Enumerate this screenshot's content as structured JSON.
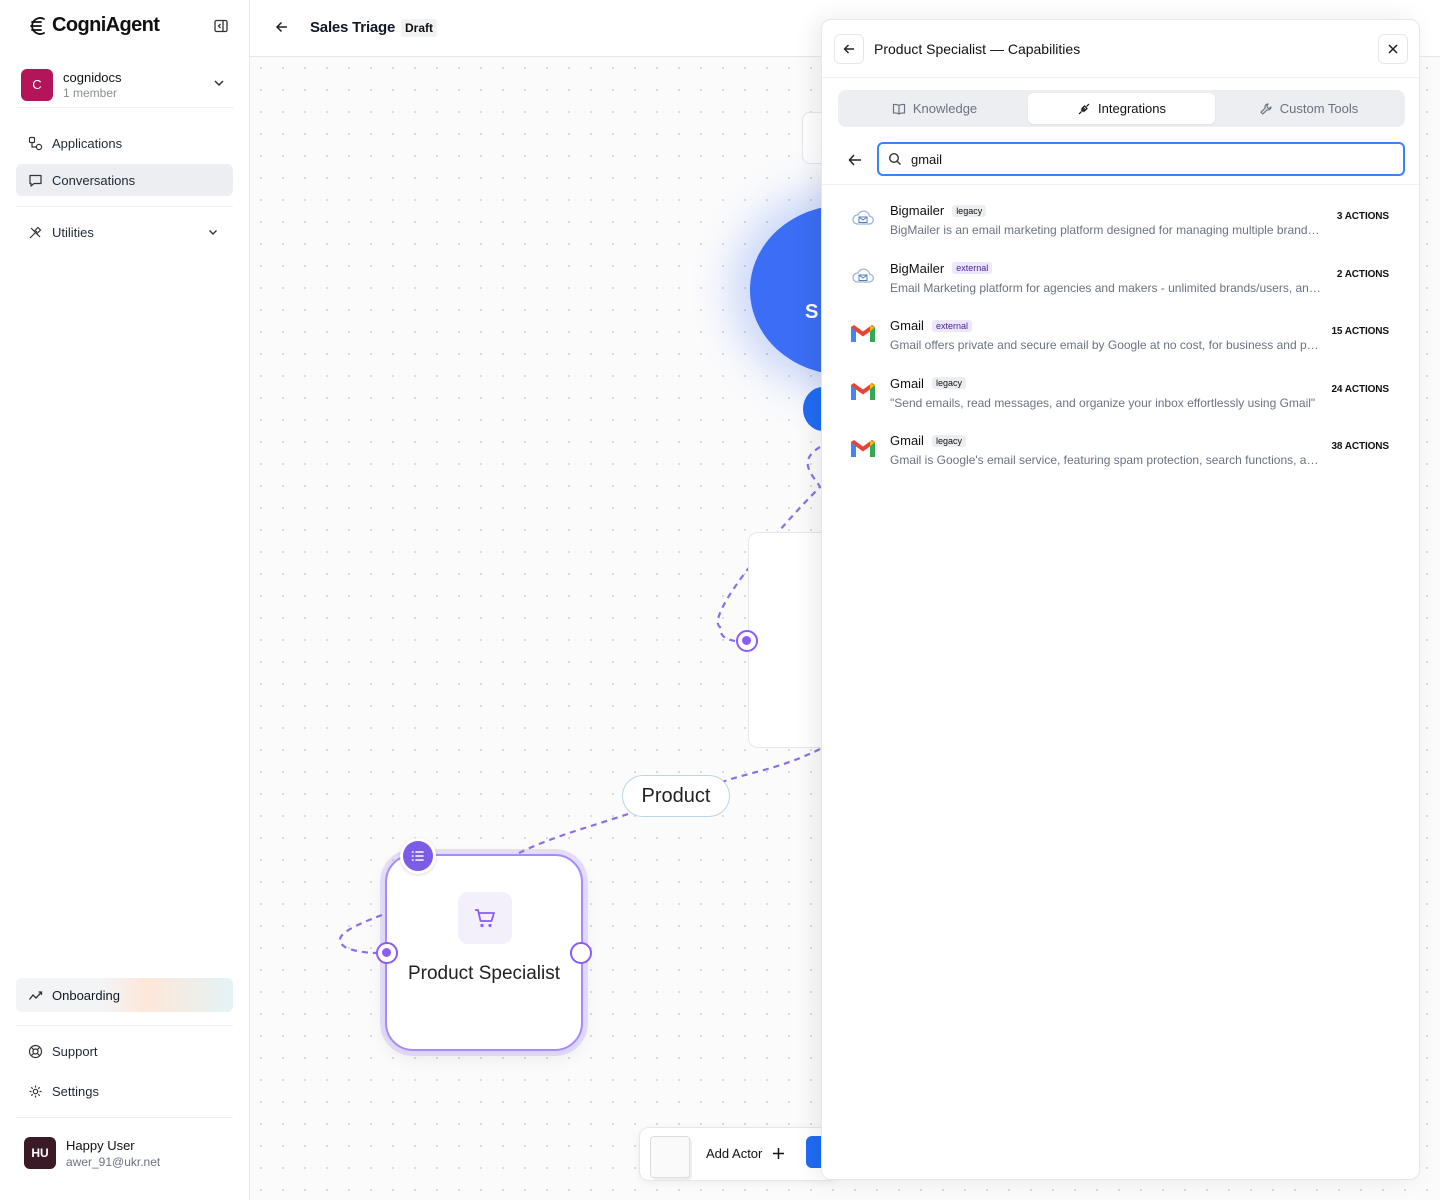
{
  "app": {
    "name": "CogniAgent"
  },
  "org": {
    "initial": "C",
    "name": "cognidocs",
    "members": "1 member"
  },
  "nav": {
    "applications": "Applications",
    "conversations": "Conversations",
    "utilities": "Utilities",
    "onboarding": "Onboarding",
    "support": "Support",
    "settings": "Settings"
  },
  "user": {
    "initials": "HU",
    "name": "Happy User",
    "email": "awer_91@ukr.net"
  },
  "header": {
    "title": "Sales Triage",
    "status": "Draft"
  },
  "canvas": {
    "start_node_label": "S",
    "edge_label": "Product",
    "actor_name": "Product Specialist",
    "add_actor": "Add Actor"
  },
  "panel": {
    "title": "Product Specialist — Capabilities",
    "tabs": [
      {
        "label": "Knowledge",
        "icon": "book-icon",
        "active": false
      },
      {
        "label": "Integrations",
        "icon": "plug-icon",
        "active": true
      },
      {
        "label": "Custom Tools",
        "icon": "wrench-icon",
        "active": false
      }
    ],
    "search": {
      "value": "gmail",
      "placeholder": ""
    },
    "results": [
      {
        "name": "Bigmailer",
        "tag": "legacy",
        "description": "BigMailer is an email marketing platform designed for managing multiple brands, with tools for audience management and campaigns",
        "actions": "3 ACTIONS",
        "icon": "cloud-mail-icon"
      },
      {
        "name": "BigMailer",
        "tag": "external",
        "description": "Email Marketing platform for agencies and makers - unlimited brands/users, and more",
        "actions": "2 ACTIONS",
        "icon": "cloud-mail-icon"
      },
      {
        "name": "Gmail",
        "tag": "external",
        "description": "Gmail offers private and secure email by Google at no cost, for business and personal use",
        "actions": "15 ACTIONS",
        "icon": "gmail-icon"
      },
      {
        "name": "Gmail",
        "tag": "legacy",
        "description": "\"Send emails, read messages, and organize your inbox effortlessly using Gmail\"",
        "actions": "24 ACTIONS",
        "icon": "gmail-icon"
      },
      {
        "name": "Gmail",
        "tag": "legacy",
        "description": "Gmail is Google's email service, featuring spam protection, search functions, and labels",
        "actions": "38 ACTIONS",
        "icon": "gmail-icon"
      }
    ]
  },
  "colors": {
    "accent": "#3b82f6",
    "actor": "#8b5cf6",
    "org_avatar": "#b3145a"
  }
}
